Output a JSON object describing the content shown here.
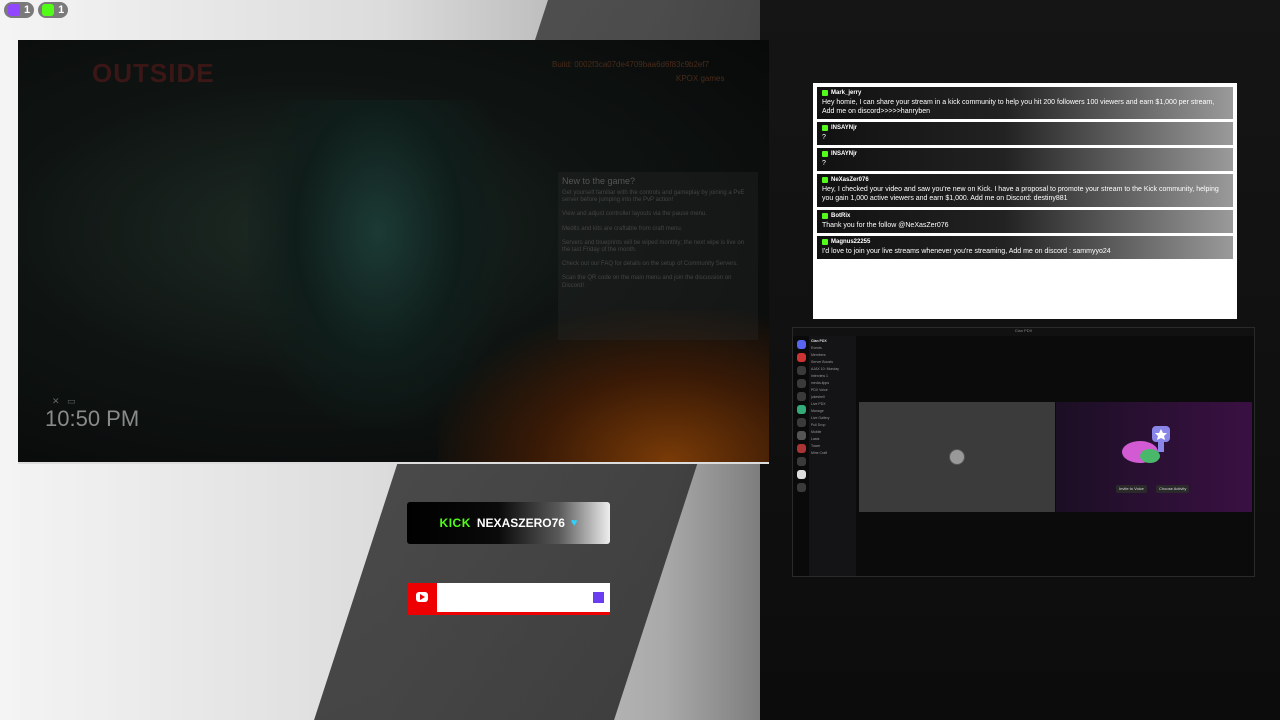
{
  "badges": [
    {
      "platform": "twitch",
      "icon": "twitch-icon",
      "count": "1"
    },
    {
      "platform": "kick",
      "icon": "kick-icon",
      "count": "1"
    }
  ],
  "game": {
    "logo": "OUTSIDE",
    "build_id": "Build: 0002f3ca07de4709baa6d6f83c9b2ef7",
    "studio": "KPOX games",
    "info_title": "New to the game?",
    "info_lines": [
      "Get yourself familiar with the controls and gameplay by joining a PvE server before jumping into the PvP action!",
      "View and adjust controller layouts via the pause menu.",
      "Medits and kits are craftable from craft menu.",
      "Servers and blueprints will be wiped monthly; the next wipe is live on the last Friday of the month.",
      "Check out our FAQ for details on the setup of Community Servers.",
      "Scan the QR code on the main menu and join the discussion on Discord!"
    ],
    "time": "10:50 PM"
  },
  "chat": {
    "messages": [
      {
        "user": "Mark_jerry",
        "text": "Hey homie, I can share your stream in a kick community to help you hit 200 followers 100 viewers and earn $1,000 per stream, Add me on discord>>>>>hanryben"
      },
      {
        "user": "INSAYNjr",
        "text": "?"
      },
      {
        "user": "INSAYNjr",
        "text": "?"
      },
      {
        "user": "NeXasZer076",
        "text": "Hey, I checked your video and saw you're new on Kick. I have a proposal to promote your stream to the Kick community, helping you gain 1,000 active viewers and earn $1,000. Add me on Discord: destiny881"
      },
      {
        "user": "BotRix",
        "text": "Thank you for the follow @NeXasZer076"
      },
      {
        "user": "Magnus22255",
        "text": "I'd love to join your live streams whenever you're streaming, Add me on discord : sammyyo24"
      }
    ]
  },
  "discord": {
    "window_title": "Clan PDX",
    "server_name": "Clan PDX",
    "channels": [
      "Events",
      "Members",
      "Server Boosts",
      "",
      "AJAX 10: Monday",
      "",
      "Interview 1",
      "media-tipps",
      "",
      "PDX Voice",
      "jukeshell",
      "",
      "Live PDX",
      "",
      "",
      "",
      "",
      "",
      "Manage",
      "",
      "Live Gallery",
      "Pull Drop",
      "Mobile",
      "Lasts",
      "Tower",
      "Mine Craft"
    ],
    "buttons": [
      "Invite to Voice",
      "Choose Activity"
    ]
  },
  "kick_banner": {
    "logo": "KICK",
    "name": "NEXASZERO76"
  },
  "youtube_banner": {
    "logo": "youtube-icon"
  }
}
